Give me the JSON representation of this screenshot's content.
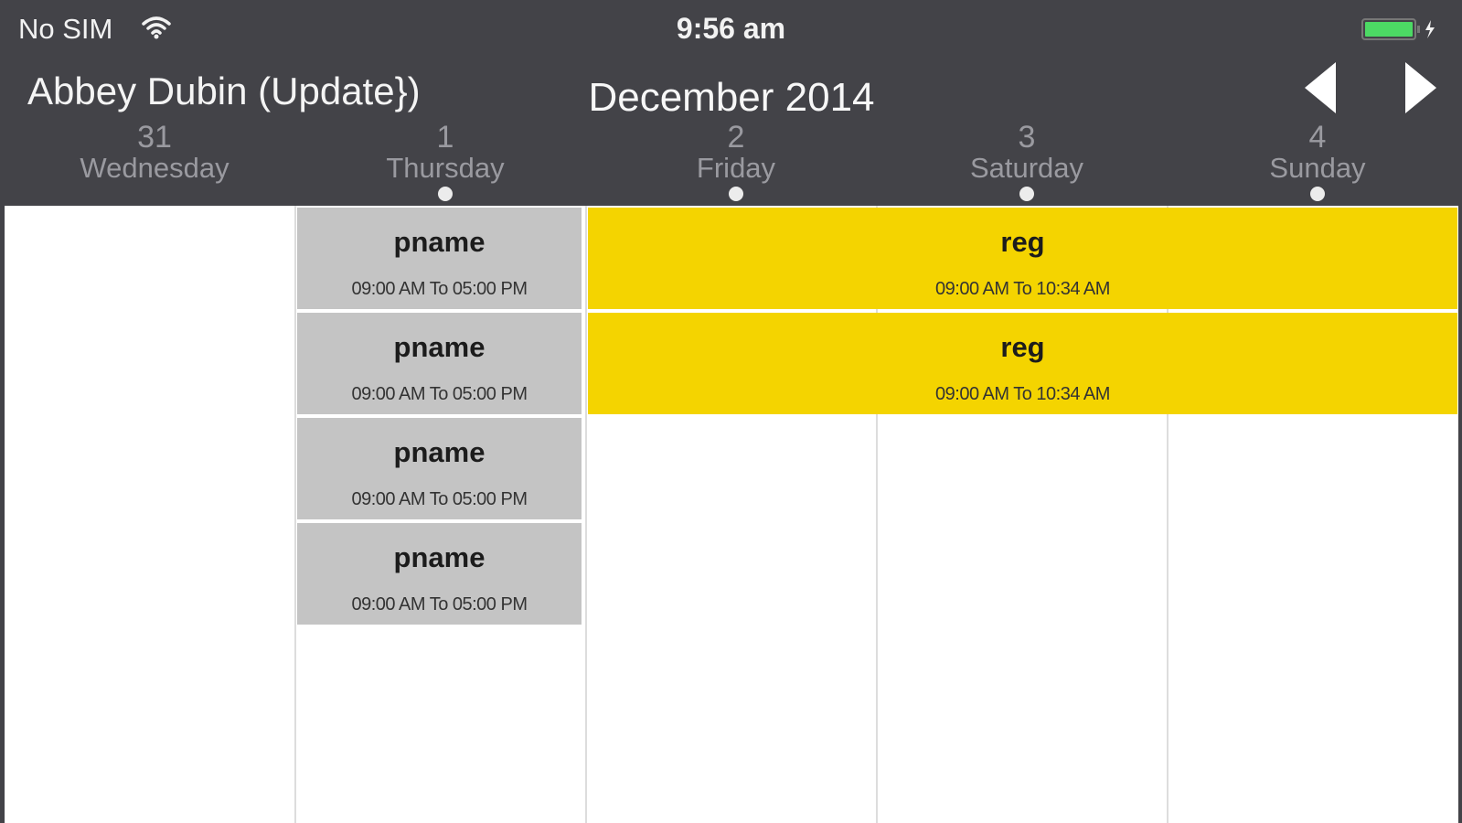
{
  "status_bar": {
    "carrier": "No SIM",
    "time": "9:56 am",
    "wifi_icon": "wifi-icon",
    "battery_icon": "battery-charging-icon",
    "battery_color": "#4cd964"
  },
  "header": {
    "user_name": "Abbey Dubin (Update})",
    "month": "December 2014",
    "prev_icon": "chevron-left-icon",
    "next_icon": "chevron-right-icon",
    "background": "#434348"
  },
  "days": [
    {
      "number": "31",
      "name": "Wednesday",
      "has_events": false
    },
    {
      "number": "1",
      "name": "Thursday",
      "has_events": true
    },
    {
      "number": "2",
      "name": "Friday",
      "has_events": true
    },
    {
      "number": "3",
      "name": "Saturday",
      "has_events": true
    },
    {
      "number": "4",
      "name": "Sunday",
      "has_events": true
    }
  ],
  "events": {
    "thursday": [
      {
        "title": "pname",
        "time": "09:00 AM To 05:00 PM"
      },
      {
        "title": "pname",
        "time": "09:00 AM To 05:00 PM"
      },
      {
        "title": "pname",
        "time": "09:00 AM To 05:00 PM"
      },
      {
        "title": "pname",
        "time": "09:00 AM To 05:00 PM"
      }
    ],
    "multi_day": [
      {
        "title": "reg",
        "time": "09:00 AM To 10:34 AM"
      },
      {
        "title": "reg",
        "time": "09:00 AM To 10:34 AM"
      }
    ]
  },
  "colors": {
    "gray_event": "#c4c4c4",
    "yellow_event": "#f4d400"
  }
}
